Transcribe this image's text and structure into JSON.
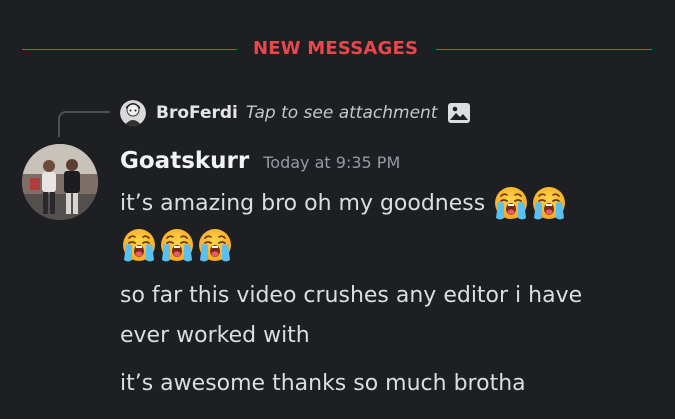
{
  "divider": {
    "label": "NEW MESSAGES",
    "color": "#e8474b"
  },
  "reply": {
    "author": "BroFerdi",
    "text": "Tap to see attachment",
    "icon": "image-icon"
  },
  "message": {
    "author": "Goatskurr",
    "timestamp": "Today at 9:35 PM",
    "lines": [
      "it’s amazing bro oh my goodness",
      "so far this video crushes any editor i have",
      "ever worked with",
      "it’s awesome thanks so much brotha"
    ],
    "emoji": "loudly-crying-face",
    "emoji_count_line1": 2,
    "emoji_count_line2": 3
  },
  "colors": {
    "background": "#1e1f22",
    "accent_red": "#e03a3e",
    "text": "#dbdee1",
    "muted": "#949ba4"
  }
}
